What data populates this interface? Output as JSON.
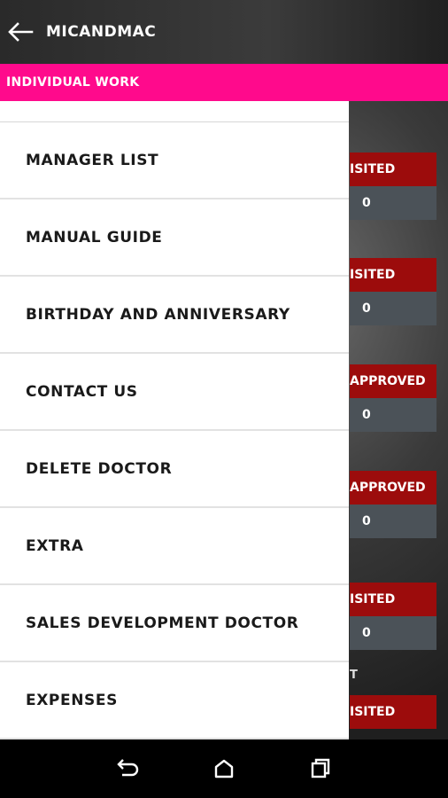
{
  "header": {
    "title": "MICANDMAC",
    "back_icon": "arrow-left-icon"
  },
  "subheader": {
    "label": "INDIVIDUAL WORK"
  },
  "drawer": {
    "items": [
      {
        "label": "MANAGER LIST"
      },
      {
        "label": "MANUAL GUIDE"
      },
      {
        "label": "BIRTHDAY AND ANNIVERSARY"
      },
      {
        "label": "CONTACT US"
      },
      {
        "label": "DELETE DOCTOR"
      },
      {
        "label": "EXTRA"
      },
      {
        "label": "SALES DEVELOPMENT DOCTOR"
      },
      {
        "label": "EXPENSES"
      }
    ]
  },
  "background_cards": [
    {
      "status": "ISITED",
      "value": "0"
    },
    {
      "status": "ISITED",
      "value": "0"
    },
    {
      "status": "APPROVED",
      "value": "0"
    },
    {
      "status": "APPROVED",
      "value": "0"
    },
    {
      "status": "ISITED",
      "value": "0"
    },
    {
      "status": "ISITED",
      "value": ""
    }
  ],
  "background_fragment": "T",
  "colors": {
    "accent": "#ff0a8c",
    "status_red": "#9c0c0c",
    "value_gray": "#4b5258"
  },
  "navbar": {
    "back_icon": "nav-back-icon",
    "home_icon": "nav-home-icon",
    "recents_icon": "nav-recents-icon"
  }
}
